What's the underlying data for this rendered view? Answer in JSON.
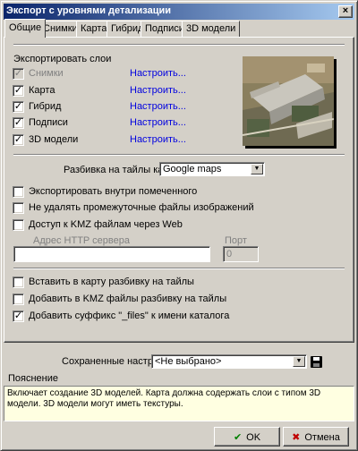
{
  "window": {
    "title": "Экспорт с уровнями детализации",
    "close_glyph": "×"
  },
  "tabs": [
    {
      "label": "Общие",
      "active": true
    },
    {
      "label": "Снимки"
    },
    {
      "label": "Карта"
    },
    {
      "label": "Гибрид"
    },
    {
      "label": "Подписи"
    },
    {
      "label": "3D модели"
    }
  ],
  "layers": {
    "heading": "Экспортировать слои",
    "items": [
      {
        "label": "Снимки",
        "checked": true,
        "enabled": false,
        "action": "Настроить..."
      },
      {
        "label": "Карта",
        "checked": true,
        "enabled": true,
        "action": "Настроить..."
      },
      {
        "label": "Гибрид",
        "checked": true,
        "enabled": true,
        "action": "Настроить..."
      },
      {
        "label": "Подписи",
        "checked": true,
        "enabled": true,
        "action": "Настроить..."
      },
      {
        "label": "3D модели",
        "checked": true,
        "enabled": true,
        "action": "Настроить..."
      }
    ]
  },
  "tiling": {
    "label": "Разбивка на тайлы как в",
    "value": "Google maps"
  },
  "options1": [
    {
      "label": "Экспортировать внутри помеченного",
      "checked": false
    },
    {
      "label": "Не удалять промежуточные файлы изображений",
      "checked": false
    },
    {
      "label": "Доступ к KMZ файлам через Web",
      "checked": false
    }
  ],
  "server": {
    "address_label": "Адрес HTTP сервера",
    "address_value": "",
    "port_label": "Порт",
    "port_value": "0"
  },
  "options2": [
    {
      "label": "Вставить в карту разбивку на тайлы",
      "checked": false
    },
    {
      "label": "Добавить в KMZ файлы разбивку на тайлы",
      "checked": false
    },
    {
      "label": "Добавить суффикс \"_files\" к имени каталога",
      "checked": true
    }
  ],
  "saved": {
    "label": "Сохраненные настройки",
    "value": "<Не выбрано>"
  },
  "description": {
    "header": "Пояснение",
    "text": "Включает создание 3D моделей. Карта должна содержать слои с типом 3D модели. 3D модели могут иметь текстуры."
  },
  "buttons": {
    "ok": "OK",
    "cancel": "Отмена"
  },
  "icons": {
    "check": "✓",
    "ok": "check-icon",
    "cancel": "cross-icon",
    "save": "floppy-disk-icon"
  },
  "colors": {
    "title_start": "#0a246a",
    "title_end": "#a6caf0",
    "link": "#0000e0",
    "ok_icon": "#008000",
    "cancel_icon": "#c00000"
  }
}
